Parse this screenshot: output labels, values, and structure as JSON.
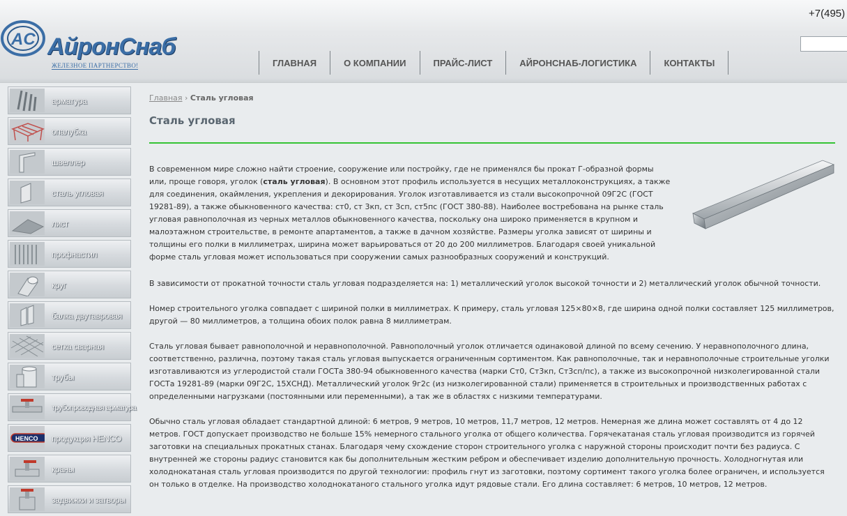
{
  "header": {
    "logo_text": "АйронСнаб",
    "logo_sub": "ЖЕЛЕЗНОЕ ПАРТНЕРСТВО!",
    "phone": "+7(495)",
    "nav": [
      "ГЛАВНАЯ",
      "О КОМПАНИИ",
      "ПРАЙС-ЛИСТ",
      "АЙРОНСНАБ-ЛОГИСТИКА",
      "КОНТАКТЫ"
    ]
  },
  "sidebar": {
    "items": [
      {
        "label": "арматура",
        "icon": "rebar-icon"
      },
      {
        "label": "опалубка",
        "icon": "formwork-icon"
      },
      {
        "label": "швеллер",
        "icon": "channel-icon"
      },
      {
        "label": "сталь угловая",
        "icon": "angle-steel-icon"
      },
      {
        "label": "лист",
        "icon": "sheet-icon"
      },
      {
        "label": "профнастил",
        "icon": "profiled-sheet-icon"
      },
      {
        "label": "круг",
        "icon": "round-bar-icon"
      },
      {
        "label": "балка двутавровая",
        "icon": "i-beam-icon"
      },
      {
        "label": "сетка сварная",
        "icon": "welded-mesh-icon"
      },
      {
        "label": "трубы",
        "icon": "pipes-icon"
      },
      {
        "label": "трубопроводная арматура",
        "icon": "pipe-fittings-icon"
      },
      {
        "label": "продукция HENCO",
        "icon": "henco-logo-icon"
      },
      {
        "label": "краны",
        "icon": "valve-icon"
      },
      {
        "label": "задвижки и затворы",
        "icon": "gate-valve-icon"
      }
    ]
  },
  "breadcrumb": {
    "home": "Главная",
    "sep": "›",
    "current": "Сталь угловая"
  },
  "page_title": "Сталь угловая",
  "intro": {
    "before": "В современном мире сложно найти строение, сооружение или постройку, где не применялся бы прокат Г-образной формы или, проще говоря, уголок (",
    "bold": "сталь угловая",
    "after": "). В основном этот профиль используется в несущих металлоконструкциях, а также для соединения, окаймления, укрепления и декорирования. Уголок изготавливается из стали высокопрочной 09Г2С (ГОСТ 19281-89), а также обыкновенного качества: ст0, ст 3кп, ст 3сп, ст5пс (ГОСТ 380-88). Наиболее востребована на рынке сталь угловая равнополочная из черных металлов обыкновенного качества, поскольку она широко применяется в крупном и малоэтажном строительстве, в ремонте апартаментов, а также в дачном хозяйстве. Размеры уголка зависят от ширины и толщины его полки в миллиметрах, ширина может варьироваться от 20 до 200 миллиметров. Благодаря своей уникальной форме сталь угловая может использоваться при сооружении самых разнообразных сооружений и конструкций."
  },
  "paragraphs": [
    "В зависимости от прокатной точности сталь угловая подразделяется на: 1) металлический уголок высокой точности и 2) металлический уголок обычной точности.",
    "Номер строительного уголка совпадает с шириной полки в миллиметрах. К примеру, сталь угловая 125×80×8, где ширина одной полки составляет 125 миллиметров, другой — 80 миллиметров, а толщина обоих полок равна 8 миллиметрам.",
    "Сталь угловая бывает равнополочной и неравнополочной. Равнополочный уголок отличается одинаковой длиной по всему сечению. У неравнополочного длина, соответственно, различна, поэтому такая сталь угловая выпускается ограниченным сортиментом. Как равнополочные, так и неравнополочные строительные уголки изготавливаются из углеродистой стали ГОСТа 380-94 обыкновенного качества (марки Ст0, Ст3кп, Ст3сп/пс), а также из высокопрочной низколегированной стали ГОСТа 19281-89 (марки 09Г2С, 15ХСНД). Металлический уголок 9г2с (из низколегированной стали) применяется в строительных и производственных работах с определенными нагрузками (постоянными или переменными), а так же в областях с низкими температурами.",
    "Обычно сталь угловая обладает стандартной длиной: 6 метров, 9 метров, 10 метров, 11,7 метров, 12 метров. Немерная же длина может составлять от 4 до 12 метров. ГОСТ допускает производство не больше 15% немерного стального уголка от общего количества. Горячекатаная сталь угловая производится из горячей заготовки на специальных прокатных станах. Благодаря чему схождение сторон строительного уголка с наружной стороны происходит почти без радиуса. С внутренней же стороны радиус становится как бы дополнительным жестким ребром и обеспечивает изделию дополнительную прочность. Холодногнутая или холоднокатаная сталь угловая производится по другой технологии: профиль гнут из заготовки, поэтому сортимент такого уголка более ограничен, и используется он только в отделке. На производство холоднокатаного стального уголка идут рядовые стали. Его длина составляет: 6 метров, 10 метров, 12 метров."
  ],
  "colors": {
    "accent_rule": "#34c334",
    "logo_blue": "#3b6ea6"
  }
}
